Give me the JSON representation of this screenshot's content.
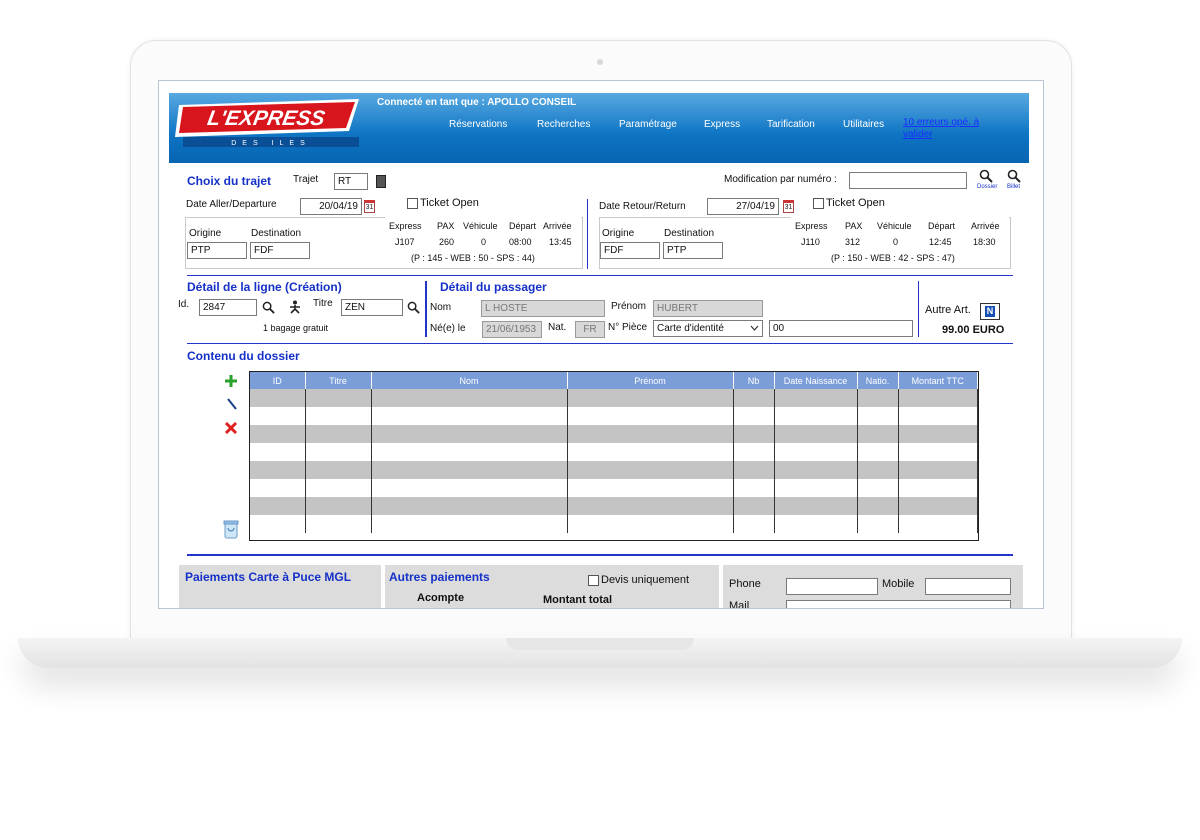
{
  "header": {
    "connected": "Connecté en tant que : APOLLO CONSEIL",
    "logo_text": "L'EXPRESS",
    "logo_sub": "D E S  Î L E S",
    "menu": [
      "Réservations",
      "Recherches",
      "Paramétrage",
      "Express",
      "Tarification",
      "Utilitaires"
    ],
    "errors_link": "10 erreurs opé. à valider"
  },
  "trajet": {
    "title": "Choix du trajet",
    "trajet_label": "Trajet",
    "trajet_value": "RT",
    "modif_label": "Modification par numéro :",
    "modif_value": "",
    "dossier_label": "Dossier",
    "billet_label": "Billet",
    "aller": {
      "date_label": "Date Aller/Departure",
      "date_value": "20/04/19",
      "ticket_open": "Ticket Open",
      "origine_label": "Origine",
      "destination_label": "Destination",
      "origine": "PTP",
      "destination": "FDF",
      "headers": [
        "Express",
        "PAX",
        "Véhicule",
        "Départ",
        "Arrivée"
      ],
      "values": [
        "J107",
        "260",
        "0",
        "08:00",
        "13:45"
      ],
      "detail": "(P : 145 - WEB : 50 - SPS : 44)"
    },
    "retour": {
      "date_label": "Date Retour/Return",
      "date_value": "27/04/19",
      "ticket_open": "Ticket Open",
      "origine_label": "Origine",
      "destination_label": "Destination",
      "origine": "FDF",
      "destination": "PTP",
      "headers": [
        "Express",
        "PAX",
        "Véhicule",
        "Départ",
        "Arrivée"
      ],
      "values": [
        "J110",
        "312",
        "0",
        "12:45",
        "18:30"
      ],
      "detail": "(P : 150 - WEB : 42 - SPS : 47)"
    }
  },
  "ligne": {
    "title": "Détail de la ligne (Création)",
    "id_label": "Id.",
    "id_value": "2847",
    "titre_label": "Titre",
    "titre_value": "ZEN",
    "bagage": "1 bagage gratuit"
  },
  "passager": {
    "title": "Détail du passager",
    "nom_label": "Nom",
    "nom_value": "L HOSTE",
    "prenom_label": "Prénom",
    "prenom_value": "HUBERT",
    "ne_label": "Né(e) le",
    "ne_value": "21/06/1953",
    "nat_label": "Nat.",
    "nat_value": "FR",
    "piece_label": "N° Pièce",
    "piece_type": "Carte d'identité",
    "piece_value": "00",
    "autre_label": "Autre Art.",
    "autre_value": "N",
    "price": "99.00 EURO"
  },
  "dossier": {
    "title": "Contenu du dossier",
    "columns": [
      "ID",
      "Titre",
      "Nom",
      "Prénom",
      "Nb",
      "Date Naissance",
      "Natio.",
      "Montant TTC"
    ]
  },
  "paiements": {
    "mgl_title": "Paiements Carte à Puce MGL",
    "autres_title": "Autres paiements",
    "devis_label": "Devis uniquement",
    "acompte_label": "Acompte",
    "montant_label": "Montant total",
    "phone_label": "Phone",
    "mobile_label": "Mobile",
    "mail_label": "Mail"
  },
  "colors": {
    "header_blue": "#0d74c3",
    "section_title": "#1430c8",
    "table_header": "#7b9ed9",
    "add_green": "#2aa12a",
    "delete_red": "#e01f1f"
  }
}
